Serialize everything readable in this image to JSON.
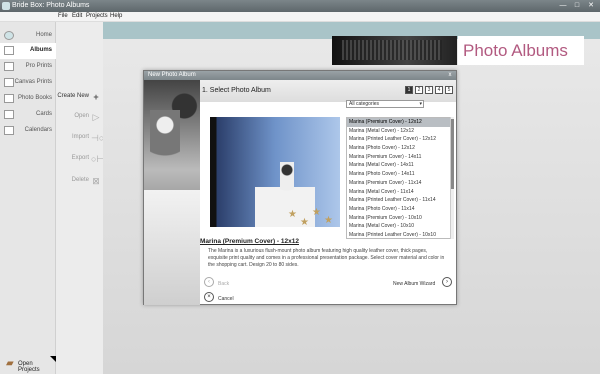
{
  "window": {
    "title": "Bride Box: Photo Albums",
    "minimize_icon": "—",
    "maximize_icon": "□",
    "close_icon": "✕"
  },
  "menu": [
    "File",
    "Edit",
    "Projects",
    "Help"
  ],
  "sidebar": {
    "items": [
      {
        "label": "Home"
      },
      {
        "label": "Albums"
      },
      {
        "label": "Pro Prints"
      },
      {
        "label": "Canvas Prints"
      },
      {
        "label": "Photo Books"
      },
      {
        "label": "Cards"
      },
      {
        "label": "Calendars"
      }
    ],
    "open_projects": "Open Projects"
  },
  "actions": [
    {
      "label": "Create New",
      "icon": "+"
    },
    {
      "label": "Open",
      "icon": "▷"
    },
    {
      "label": "Import",
      "icon": "⊣○"
    },
    {
      "label": "Export",
      "icon": "○⊢"
    },
    {
      "label": "Delete",
      "icon": "⊠"
    }
  ],
  "page_title": "Photo Albums",
  "dialog": {
    "title": "New Photo Album",
    "close": "x",
    "step_title": "1. Select Photo Album",
    "steps": [
      "1",
      "2",
      "3",
      "4",
      "5"
    ],
    "category": "All categories",
    "albums": [
      "Marina (Premium Cover) - 12x12",
      "Marina (Metal Cover) - 12x12",
      "Marina (Printed Leather Cover) - 12x12",
      "Marina (Photo Cover) - 12x12",
      "Marina (Premium Cover) - 14x11",
      "Marina (Metal Cover) - 14x11",
      "Marina (Photo Cover) - 14x11",
      "Marina (Premium Cover) - 11x14",
      "Marina (Metal Cover) - 11x14",
      "Marina (Printed Leather Cover) - 11x14",
      "Marina (Photo Cover) - 11x14",
      "Marina (Premium Cover) - 10x10",
      "Marina (Metal Cover) - 10x10",
      "Marina (Printed Leather Cover) - 10x10"
    ],
    "selected_name": "Marina (Premium Cover) - 12x12",
    "description": "The Marina is a luxurious flush-mount photo album featuring high quality leather cover, thick pages, exquisite print quality and comes in a professional presentation package. Select cover material and color in the shopping cart. Design 20 to 80 sides.",
    "back": "Back",
    "wizard": "New Album Wizard",
    "cancel": "Cancel"
  }
}
